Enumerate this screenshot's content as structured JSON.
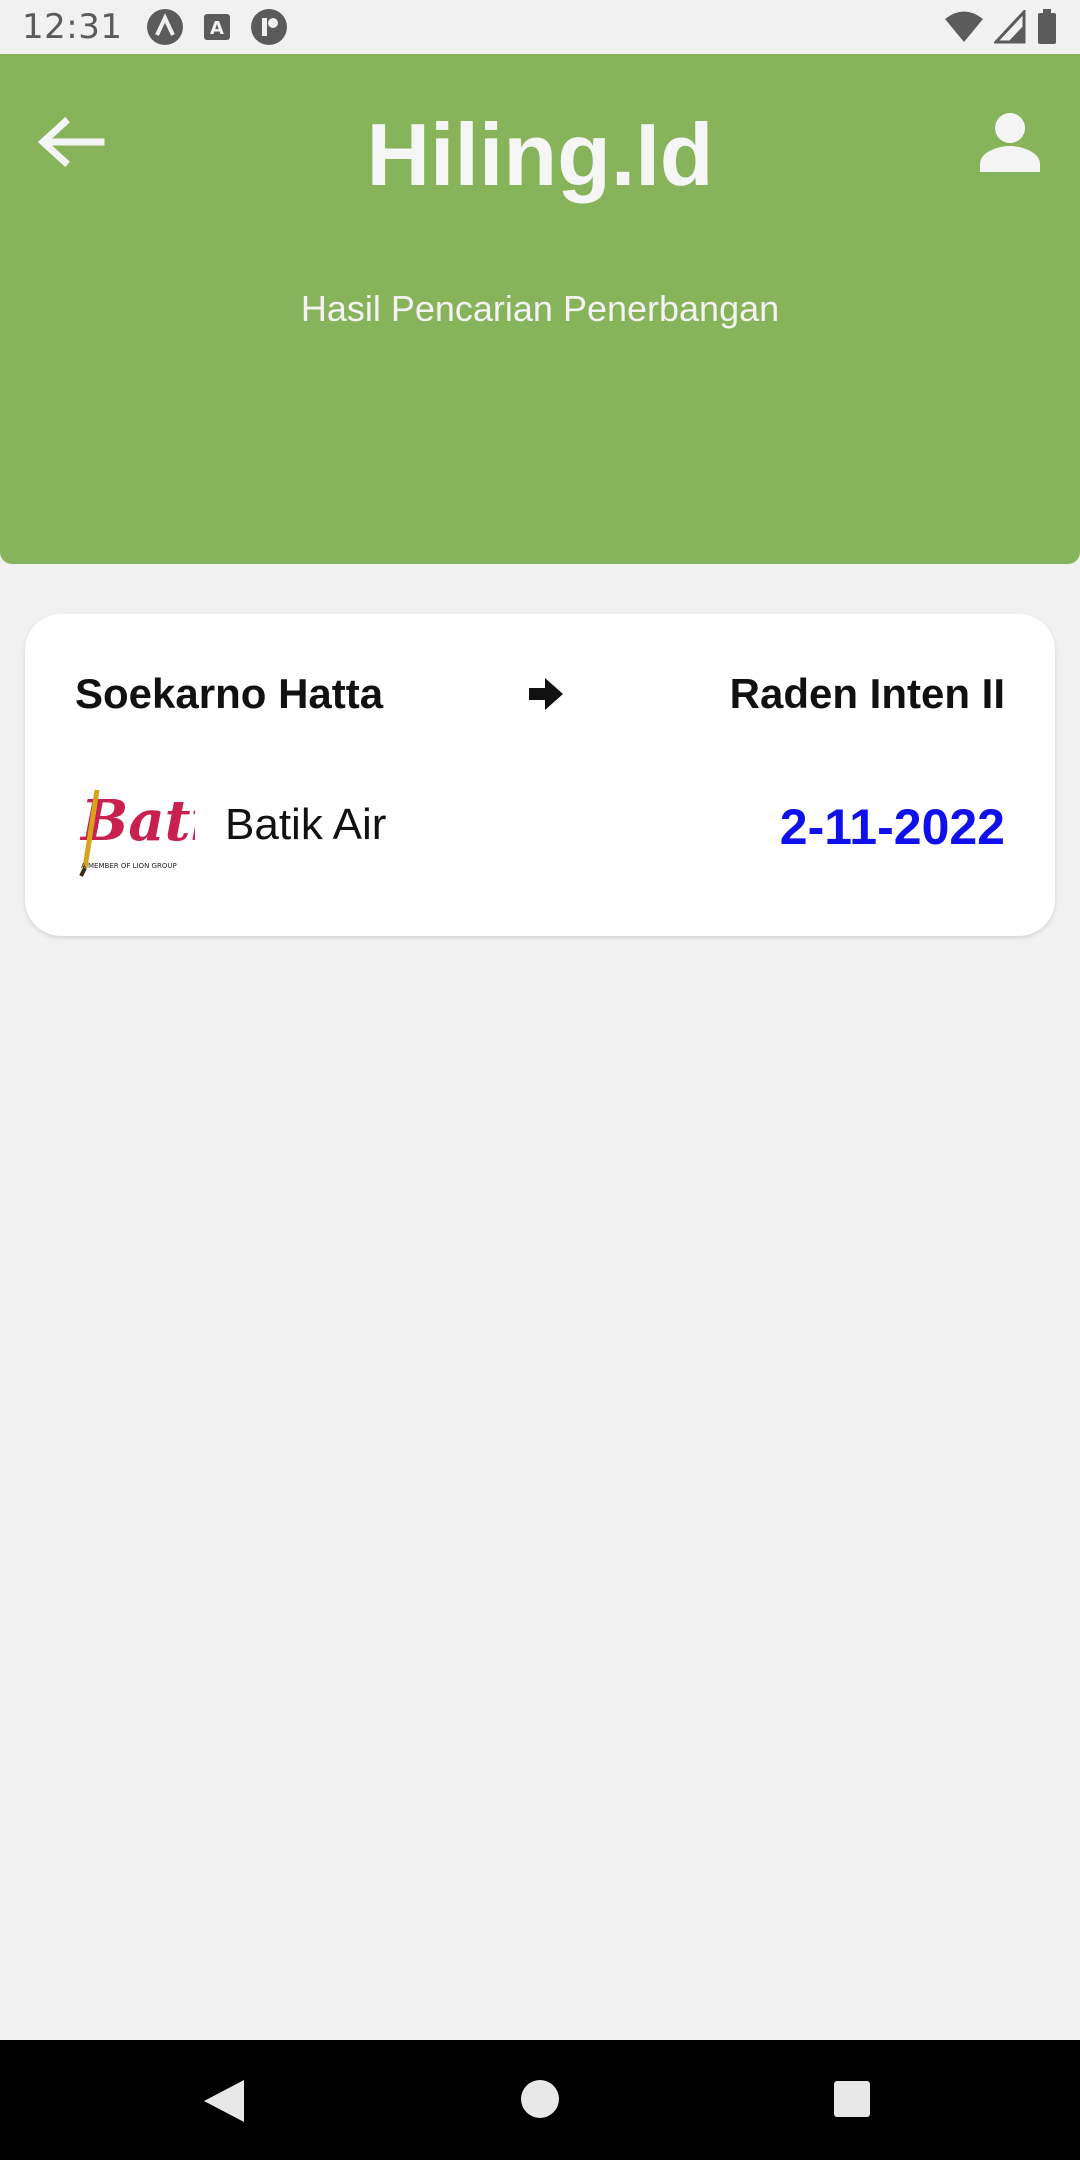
{
  "status_bar": {
    "time": "12:31",
    "left_icons": [
      "android-notification-icon",
      "a-box-notification-icon",
      "pause-notification-icon"
    ],
    "right_icons": [
      "wifi-icon",
      "cell-signal-icon",
      "battery-icon"
    ]
  },
  "header": {
    "title": "Hiling.Id",
    "subtitle": "Hasil Pencarian Penerbangan",
    "back_icon": "arrow-left-icon",
    "profile_icon": "person-icon",
    "background_color": "#87b35a"
  },
  "result": {
    "from": "Soekarno Hatta",
    "to": "Raden Inten II",
    "arrow_icon": "arrow-right-icon",
    "airline_name": "Batik Air",
    "logo_text": "Batik",
    "logo_tagline": "A MEMBER OF LION GROUP",
    "date": "2-11-2022",
    "date_color": "#1010ea"
  },
  "nav_bar": {
    "buttons": [
      "back-triangle-icon",
      "home-circle-icon",
      "recents-square-icon"
    ]
  }
}
